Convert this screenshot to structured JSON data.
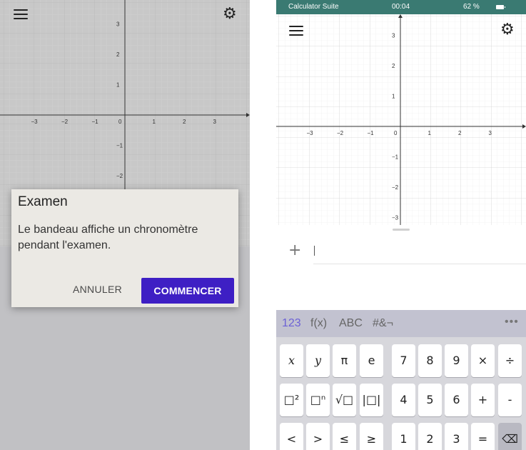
{
  "left_screen": {
    "graph": {
      "x_ticks": [
        "−3",
        "−2",
        "−1",
        "0",
        "1",
        "2",
        "3"
      ],
      "y_ticks": [
        "3",
        "2",
        "1",
        "−1",
        "−2"
      ]
    },
    "dialog": {
      "title": "Examen",
      "message": "Le bandeau affiche un chronomètre pendant l'examen.",
      "cancel_label": "ANNULER",
      "start_label": "COMMENCER",
      "start_color": "#3e1fc4"
    }
  },
  "right_screen": {
    "status_bar": {
      "app_name": "Calculator Suite",
      "time": "00:04",
      "battery": "62 %",
      "color": "#3a7a72"
    },
    "graph": {
      "x_ticks": [
        "−3",
        "−2",
        "−1",
        "0",
        "1",
        "2",
        "3"
      ],
      "y_ticks": [
        "3",
        "2",
        "1",
        "−1",
        "−2",
        "−3"
      ]
    },
    "algebra": {
      "add_label": "+"
    },
    "keyboard": {
      "tabs": [
        "123",
        "f(x)",
        "ABC",
        "#&¬"
      ],
      "active_tab": "123",
      "more_label": "•••",
      "rows": [
        [
          "x",
          "y",
          "π",
          "e",
          "7",
          "8",
          "9",
          "×",
          "÷"
        ],
        [
          "□²",
          "□ⁿ",
          "√□",
          "|□|",
          "4",
          "5",
          "6",
          "+",
          "-"
        ],
        [
          "<",
          ">",
          "≤",
          "≥",
          "1",
          "2",
          "3",
          "=",
          "⌫"
        ]
      ]
    }
  }
}
